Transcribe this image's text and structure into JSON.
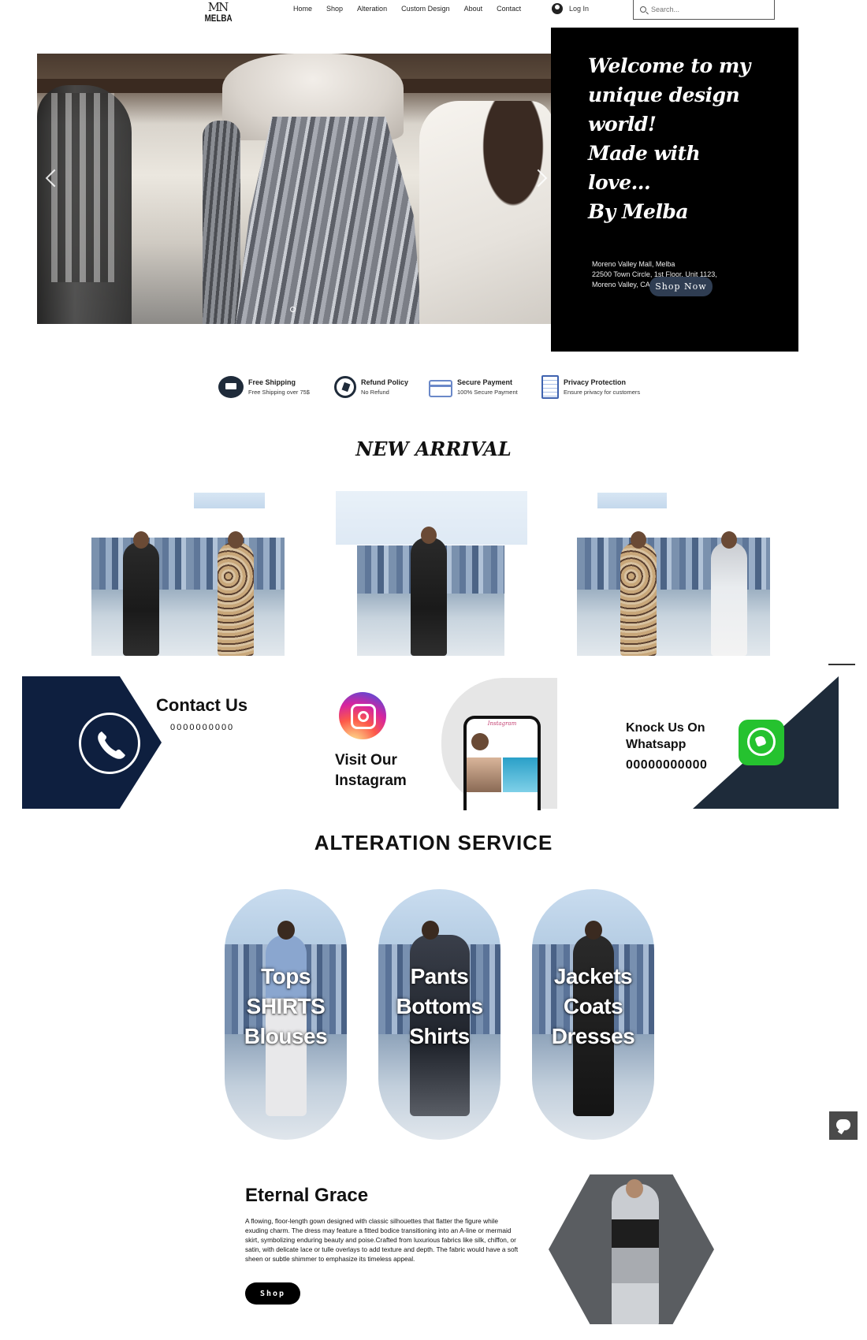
{
  "header": {
    "logo_mark": "MN",
    "logo_name": "MELBA",
    "nav": [
      "Home",
      "Shop",
      "Alteration",
      "Custom Design",
      "About",
      "Contact"
    ],
    "login_label": "Log In",
    "search_placeholder": "Search..."
  },
  "hero": {
    "welcome_text": "Welcome to my\nunique design world!\nMade with\nlove...\nBy Melba",
    "address": "Moreno Valley Mall, Melba\n22500 Town Circle, 1st Floor, Unit 1123,\nMoreno Valley, CA, 92553",
    "shop_now_label": "Shop Now"
  },
  "features": [
    {
      "icon": "truck-icon",
      "title": "Free Shipping",
      "subtitle": "Free Shipping over 75$"
    },
    {
      "icon": "refund-icon",
      "title": "Refund Policy",
      "subtitle": "No Refund"
    },
    {
      "icon": "card-icon",
      "title": "Secure Payment",
      "subtitle": "100% Secure Payment"
    },
    {
      "icon": "document-icon",
      "title": "Privacy Protection",
      "subtitle": "Ensure privacy for customers"
    }
  ],
  "new_arrival": {
    "title": "NEW ARRIVAL"
  },
  "contact": {
    "title": "Contact Us",
    "number": "0000000000",
    "instagram_label": "Visit Our\nInstagram",
    "instagram_phone_header": "Instagram",
    "whatsapp_label": "Knock Us On\nWhatsapp",
    "whatsapp_number": "00000000000"
  },
  "alteration": {
    "title": "ALTERATION SERVICE",
    "items": [
      {
        "label": "Tops\nSHIRTS\nBlouses"
      },
      {
        "label": "Pants\nBottoms\nShirts"
      },
      {
        "label": "Jackets\nCoats\nDresses"
      }
    ]
  },
  "eternal_grace": {
    "title": "Eternal Grace",
    "description": "A flowing, floor-length gown designed with classic silhouettes that flatter the figure while exuding charm. The dress may feature a fitted bodice transitioning into an A-line or mermaid skirt, symbolizing enduring beauty and poise.Crafted from luxurious fabrics like silk, chiffon, or satin, with delicate lace or tulle overlays to add texture and depth. The fabric would have a soft sheen or subtle shimmer to emphasize its timeless appeal.",
    "shop_label": "Shop"
  },
  "colors": {
    "navy": "#0e1f3f",
    "button_blue": "#2f3d52",
    "whatsapp_green": "#25c22f",
    "dark_slate": "#1e2b3a"
  }
}
